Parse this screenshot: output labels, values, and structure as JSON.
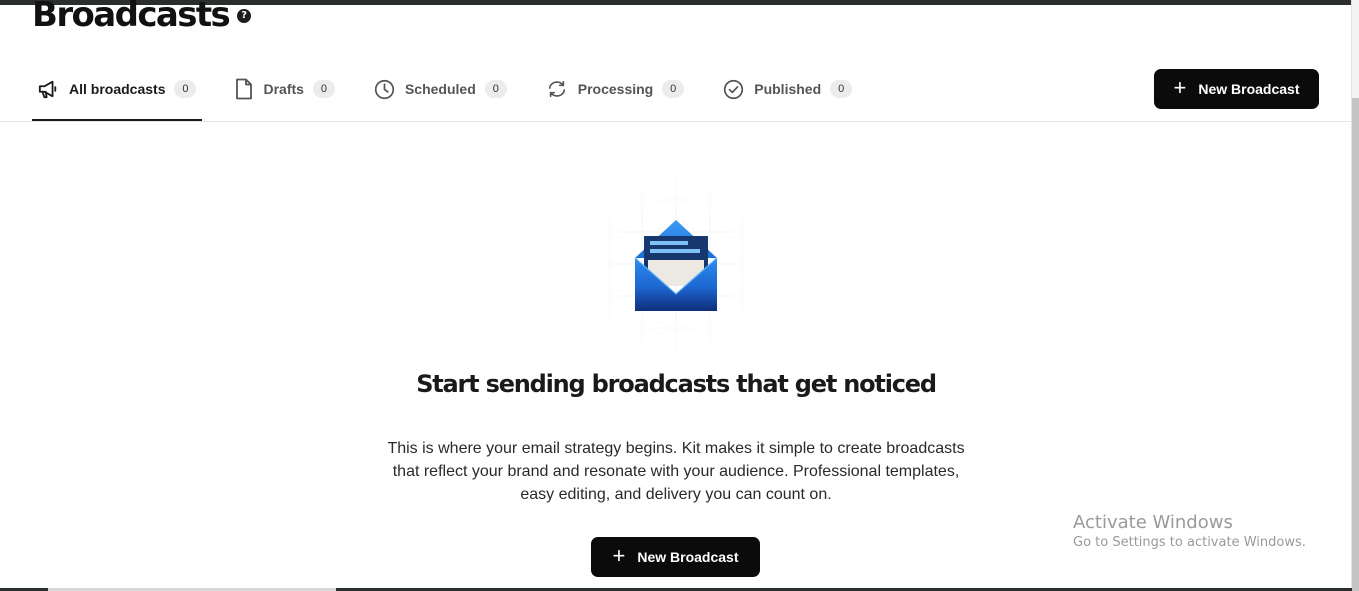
{
  "page": {
    "title": "Broadcasts",
    "help_symbol": "?"
  },
  "tabs": [
    {
      "label": "All broadcasts",
      "count": "0",
      "icon": "megaphone-icon",
      "active": true
    },
    {
      "label": "Drafts",
      "count": "0",
      "icon": "document-icon",
      "active": false
    },
    {
      "label": "Scheduled",
      "count": "0",
      "icon": "clock-icon",
      "active": false
    },
    {
      "label": "Processing",
      "count": "0",
      "icon": "refresh-icon",
      "active": false
    },
    {
      "label": "Published",
      "count": "0",
      "icon": "check-circle-icon",
      "active": false
    }
  ],
  "header": {
    "new_button_label": "New Broadcast"
  },
  "empty_state": {
    "title": "Start sending broadcasts that get noticed",
    "description": "This is where your email strategy begins. Kit makes it simple to create broadcasts that reflect your brand and resonate with your audience. Professional templates, easy editing, and delivery you can count on.",
    "button_label": "New Broadcast",
    "illustration_icon": "open-envelope-icon"
  },
  "watermark": {
    "title": "Activate Windows",
    "subtitle": "Go to Settings to activate Windows."
  },
  "colors": {
    "primary_button": "#0b0b0b",
    "envelope_blue": "#1f7fe6",
    "envelope_dark": "#0f2d72"
  }
}
